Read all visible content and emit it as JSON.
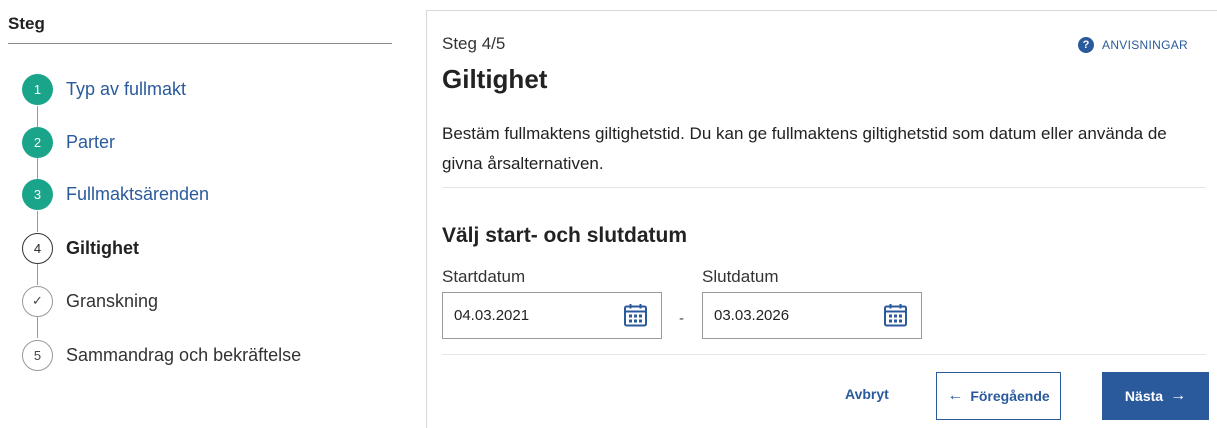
{
  "sidebar": {
    "title": "Steg",
    "steps": [
      {
        "number": "1",
        "label": "Typ av fullmakt",
        "state": "done"
      },
      {
        "number": "2",
        "label": "Parter",
        "state": "done"
      },
      {
        "number": "3",
        "label": "Fullmaktsärenden",
        "state": "done"
      },
      {
        "number": "4",
        "label": "Giltighet",
        "state": "current"
      },
      {
        "number": "✓",
        "label": "Granskning",
        "state": "todo"
      },
      {
        "number": "5",
        "label": "Sammandrag och bekräftelse",
        "state": "todo"
      }
    ]
  },
  "main": {
    "step_count": "Steg 4/5",
    "title": "Giltighet",
    "help_label": "ANVISNINGAR",
    "description": "Bestäm fullmaktens giltighetstid. Du kan ge fullmaktens giltighetstid som datum eller använda de givna årsalternativen.",
    "section_title": "Välj start- och slutdatum",
    "start_label": "Startdatum",
    "start_value": "04.03.2021",
    "separator": "-",
    "end_label": "Slutdatum",
    "end_value": "03.03.2026"
  },
  "actions": {
    "cancel": "Avbryt",
    "previous": "Föregående",
    "next": "Nästa"
  },
  "colors": {
    "accent": "#2a5a9c",
    "done": "#1aa58a"
  },
  "icons": [
    "help-icon",
    "calendar-icon",
    "arrow-left-icon",
    "arrow-right-icon",
    "check-icon"
  ]
}
